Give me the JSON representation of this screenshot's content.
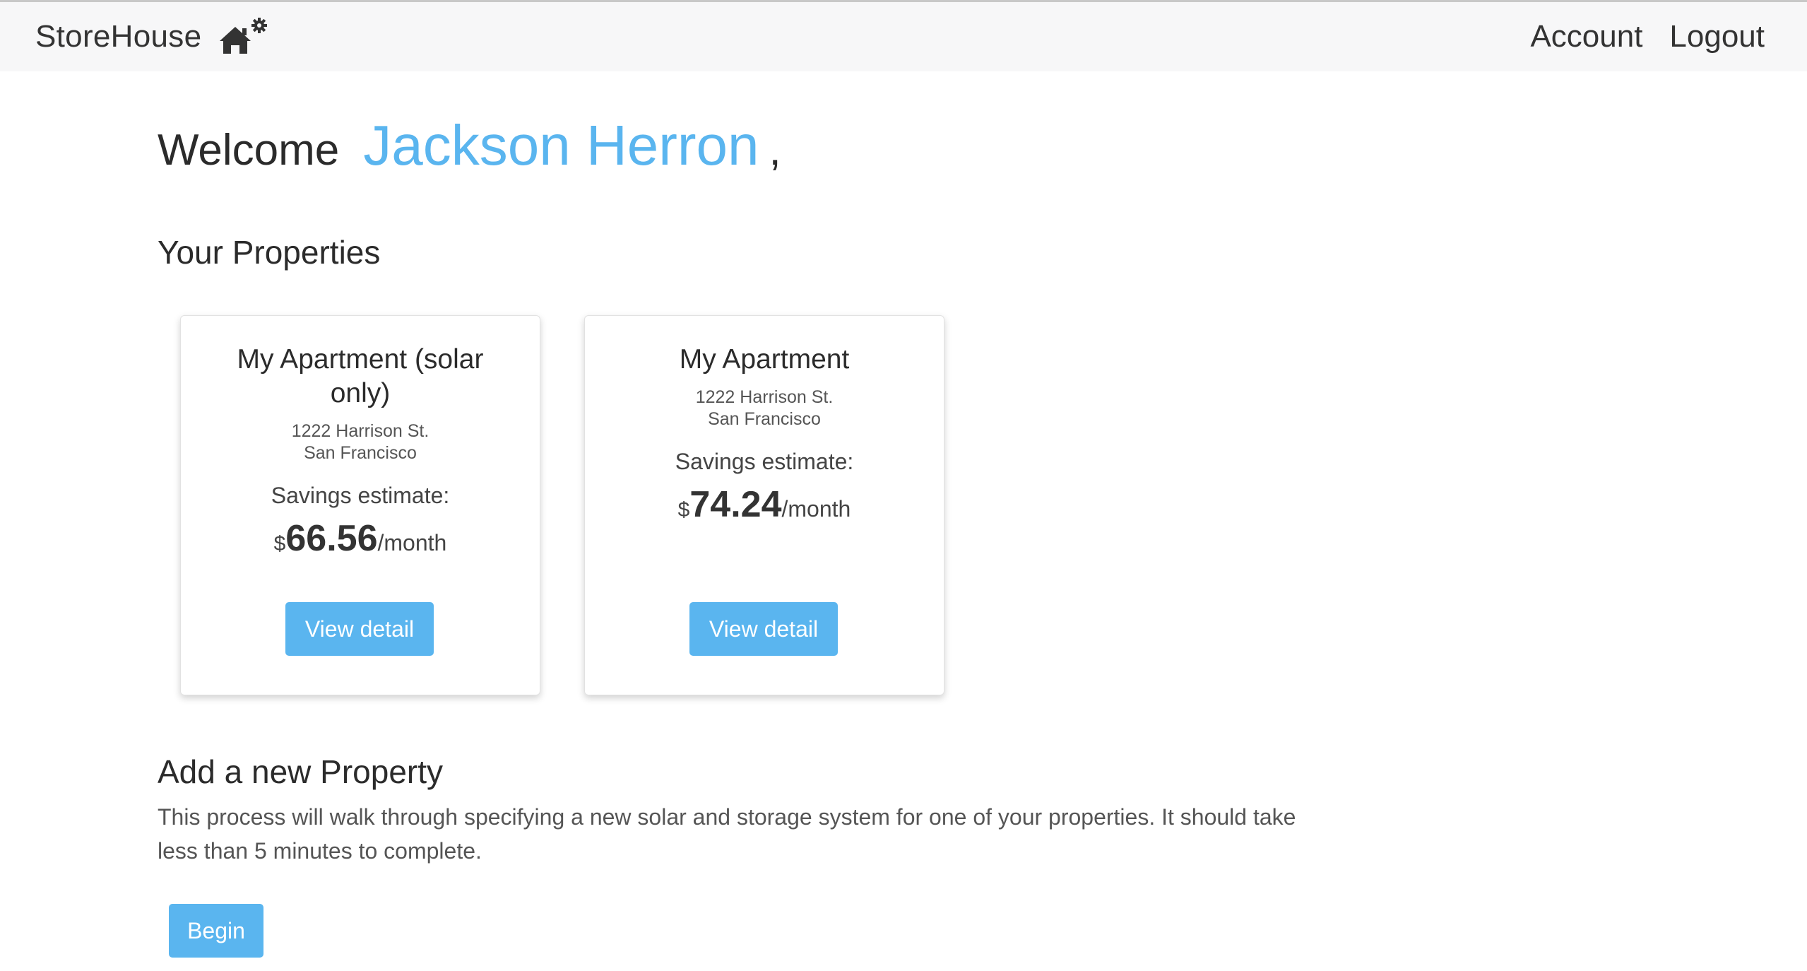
{
  "navbar": {
    "brand": "StoreHouse",
    "brand_icon": "house-gear-icon",
    "links": [
      "Account",
      "Logout"
    ]
  },
  "welcome": {
    "greeting": "Welcome",
    "name": "Jackson Herron",
    "comma": ","
  },
  "properties_section": {
    "title": "Your Properties",
    "cards": [
      {
        "title": "My Apartment (solar only)",
        "address_line1": "1222 Harrison St.",
        "address_line2": "San Francisco",
        "savings_label": "Savings estimate:",
        "currency": "$",
        "amount": "66.56",
        "period": "/month",
        "button": "View detail"
      },
      {
        "title": "My Apartment",
        "address_line1": "1222 Harrison St.",
        "address_line2": "San Francisco",
        "savings_label": "Savings estimate:",
        "currency": "$",
        "amount": "74.24",
        "period": "/month",
        "button": "View detail"
      }
    ]
  },
  "add_section": {
    "title": "Add a new Property",
    "description": "This process will walk through specifying a new solar and storage system for one of your properties. It should take less than 5 minutes to complete.",
    "button": "Begin"
  },
  "colors": {
    "accent": "#5ab5ef",
    "navbar_bg": "#f7f7f8",
    "text": "#333333"
  }
}
